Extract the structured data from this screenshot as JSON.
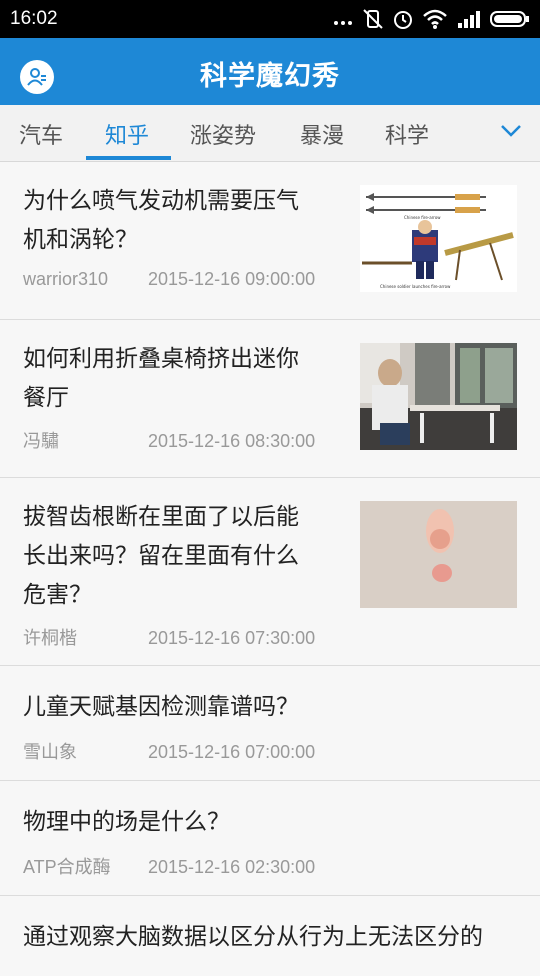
{
  "status_bar": {
    "time": "16:02",
    "icons": [
      "more-dots-icon",
      "mute-vibrate-icon",
      "alarm-icon",
      "wifi-icon",
      "signal-icon",
      "battery-icon"
    ]
  },
  "app_bar": {
    "title": "科学魔幻秀",
    "avatar_icon": "profile-icon",
    "color": "#1e88d6"
  },
  "tabs": {
    "items": [
      {
        "label": "汽车",
        "active": false
      },
      {
        "label": "知乎",
        "active": true
      },
      {
        "label": "涨姿势",
        "active": false
      },
      {
        "label": "暴漫",
        "active": false
      },
      {
        "label": "科学",
        "active": false
      }
    ],
    "more_icon": "chevron-down-icon"
  },
  "feed": {
    "items": [
      {
        "line1": "为什么喷气发动机需要压气",
        "line2": "机和涡轮？",
        "author": "warrior310",
        "time": "2015-12-16 09:00:00",
        "thumb_caption": "Chinese soldier launches fire-arrow",
        "thumb_label": "Chinese fire-arrow"
      },
      {
        "line1": "如何利用折叠桌椅挤出迷你",
        "line2": "餐厅",
        "author": "冯驌",
        "time": "2015-12-16 08:30:00"
      },
      {
        "line1": "拔智齿根断在里面了以后能",
        "line2": "长出来吗？留在里面有什么",
        "line3": "危害？",
        "author": "许桐楷",
        "time": "2015-12-16 07:30:00"
      },
      {
        "line1": "儿童天赋基因检测靠谱吗？",
        "author": "雪山象",
        "time": "2015-12-16 07:00:00"
      },
      {
        "line1": "物理中的场是什么？",
        "author": "ATP合成酶",
        "time": "2015-12-16 02:30:00"
      },
      {
        "line1": "通过观察大脑数据以区分从行为上无法区分的"
      }
    ]
  }
}
